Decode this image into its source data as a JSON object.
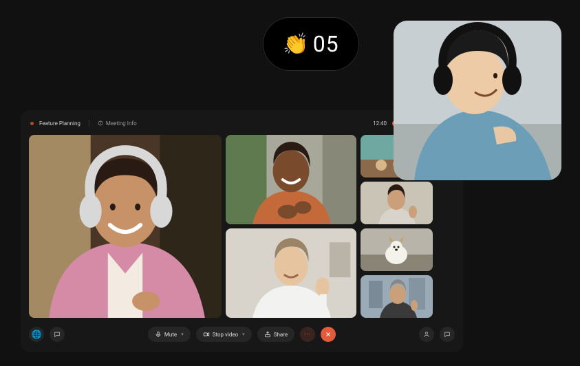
{
  "reaction_badge": {
    "emoji": "👏",
    "count": "05"
  },
  "window": {
    "title": "Feature Planning",
    "info_label": "Meeting Info",
    "clock": "12:40",
    "controls": {
      "mute": "Mute",
      "stop_video": "Stop video",
      "share": "Share",
      "more": "···",
      "end": "✕"
    }
  },
  "participants": {
    "main": "participant-main",
    "mid": [
      "participant-2",
      "participant-3"
    ],
    "side": [
      "participant-4",
      "participant-5",
      "participant-6",
      "participant-7"
    ]
  },
  "floating_participant": "participant-headphones"
}
